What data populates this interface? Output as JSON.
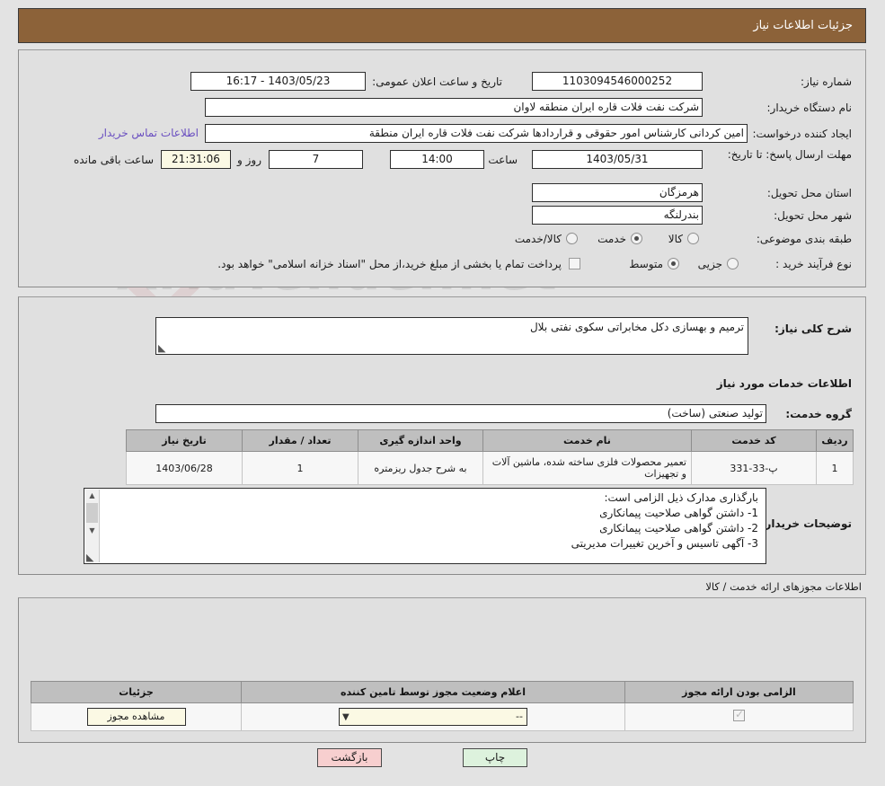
{
  "header": {
    "title": "جزئیات اطلاعات نیاز"
  },
  "watermark": {
    "text": "AriaTender.net"
  },
  "top": {
    "need_number_label": "شماره نیاز:",
    "need_number_value": "1103094546000252",
    "buyer_org_label": "نام دستگاه خریدار:",
    "buyer_org_value": "شرکت نفت فلات قاره ایران منطقه لاوان",
    "creator_label": "ایجاد کننده درخواست:",
    "creator_value": "امین کردانی کارشناس امور حقوقی و قراردادها شرکت نفت فلات قاره ایران منطقة",
    "contact_link": "اطلاعات تماس خریدار",
    "deadline_label": "مهلت ارسال پاسخ: تا تاریخ:",
    "deadline_date": "1403/05/31",
    "hour_label": "ساعت",
    "hour_value": "14:00",
    "days_value": "7",
    "days_label": "روز و",
    "countdown_value": "21:31:06",
    "countdown_label": "ساعت باقی مانده",
    "announce_label": "تاریخ و ساعت اعلان عمومی:",
    "announce_value": "1403/05/23 - 16:17",
    "province_label": "استان محل تحویل:",
    "province_value": "هرمزگان",
    "city_label": "شهر محل تحویل:",
    "city_value": "بندرلنگه",
    "classification_label": "طبقه بندی موضوعی:",
    "classification_options": [
      "کالا",
      "خدمت",
      "کالا/خدمت"
    ],
    "classification_selected": "خدمت",
    "process_label": "نوع فرآیند خرید :",
    "process_options": [
      "جزیی",
      "متوسط"
    ],
    "process_selected": "متوسط",
    "treasury_note": "پرداخت تمام یا بخشی از مبلغ خرید،از محل \"اسناد خزانه اسلامی\" خواهد بود.",
    "treasury_checked": false
  },
  "middle": {
    "general_desc_label": "شرح کلی نیاز:",
    "general_desc_value": "ترمیم و بهسازی دکل مخابراتی سکوی نفتی بلال",
    "services_info_title": "اطلاعات خدمات مورد نیاز",
    "service_group_label": "گروه خدمت:",
    "service_group_value": "تولید صنعتی (ساخت)"
  },
  "services_table": {
    "headers": [
      "ردیف",
      "کد خدمت",
      "نام خدمت",
      "واحد اندازه گیری",
      "تعداد / مقدار",
      "تاریخ نیاز"
    ],
    "rows": [
      {
        "row": "1",
        "code": "پ-33-331",
        "name": "تعمیر محصولات فلزی ساخته شده، ماشین آلات و تجهیزات",
        "unit": "به شرح جدول ریزمتره",
        "qty": "1",
        "date": "1403/06/28"
      }
    ]
  },
  "buyer_notes": {
    "label": "توضیحات خریدار:",
    "lines": [
      "بارگذاری مدارک ذیل الزامی است:",
      "1-    داشتن گواهی صلاحیت پیمانکاری",
      "2-      داشتن گواهی صلاحیت پیمانکاری",
      "3-    آگهی تاسیس و آخرین تغییرات مدیریتی"
    ]
  },
  "licenses": {
    "section_title": "اطلاعات مجوزهای ارائه خدمت / کالا",
    "headers": [
      "الزامی بودن ارائه مجوز",
      "اعلام وضعیت مجوز توسط تامین کننده",
      "جزئیات"
    ],
    "rows": [
      {
        "required_checked": true,
        "status_value": "--",
        "details_button": "مشاهده مجوز"
      }
    ]
  },
  "footer": {
    "back_label": "بازگشت",
    "print_label": "چاپ"
  }
}
